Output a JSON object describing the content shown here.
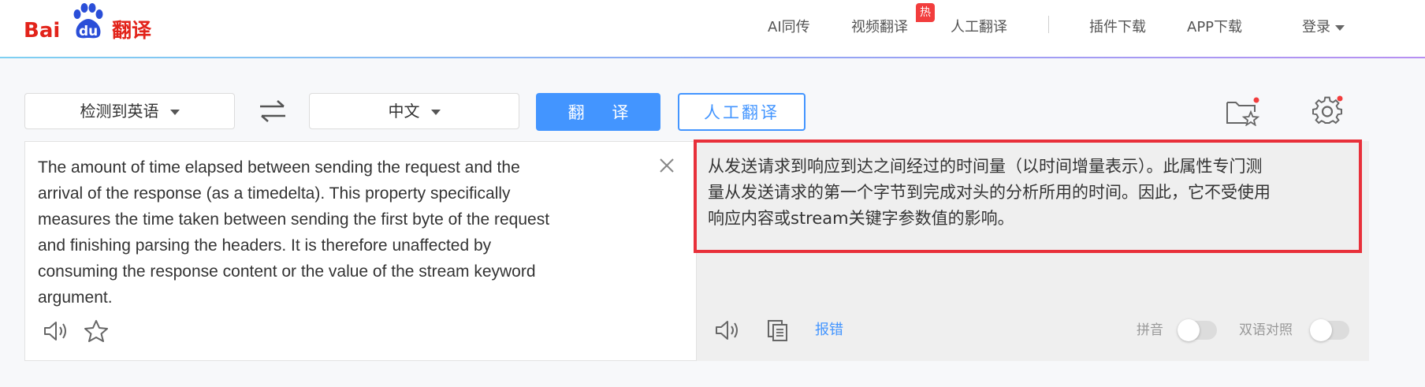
{
  "header": {
    "logo": {
      "bai": "Bai",
      "du": "du",
      "fanyi": "翻译"
    },
    "nav": {
      "ai_simultaneous": "AI同传",
      "video_translate": "视频翻译",
      "hot_badge": "热",
      "human_translate": "人工翻译",
      "plugin_download": "插件下载",
      "app_download": "APP下载",
      "login": "登录"
    }
  },
  "toolbar": {
    "source_language": "检测到英语",
    "target_language": "中文",
    "translate_button": "翻 译",
    "human_translate_button": "人工翻译"
  },
  "source": {
    "lines": [
      "The amount of time elapsed between sending the request and the",
      "arrival of the response (as a timedelta). This property specifically",
      "measures the time taken between sending the first byte of the request",
      "and finishing parsing the headers. It is therefore unaffected by",
      "consuming the response content or the value of the stream keyword",
      "argument."
    ]
  },
  "target": {
    "lines": [
      "从发送请求到响应到达之间经过的时间量（以时间增量表示）。此属性专门测",
      "量从发送请求的第一个字节到完成对头的分析所用的时间。因此，它不受使用",
      "响应内容或stream关键字参数值的影响。"
    ],
    "report_error": "报错",
    "pinyin_label": "拼音",
    "bilingual_label": "双语对照"
  },
  "colors": {
    "brand_red": "#e2231a",
    "brand_blue": "#2a4ed8",
    "accent_blue": "#4395ff",
    "highlight_red": "#e8303a"
  }
}
